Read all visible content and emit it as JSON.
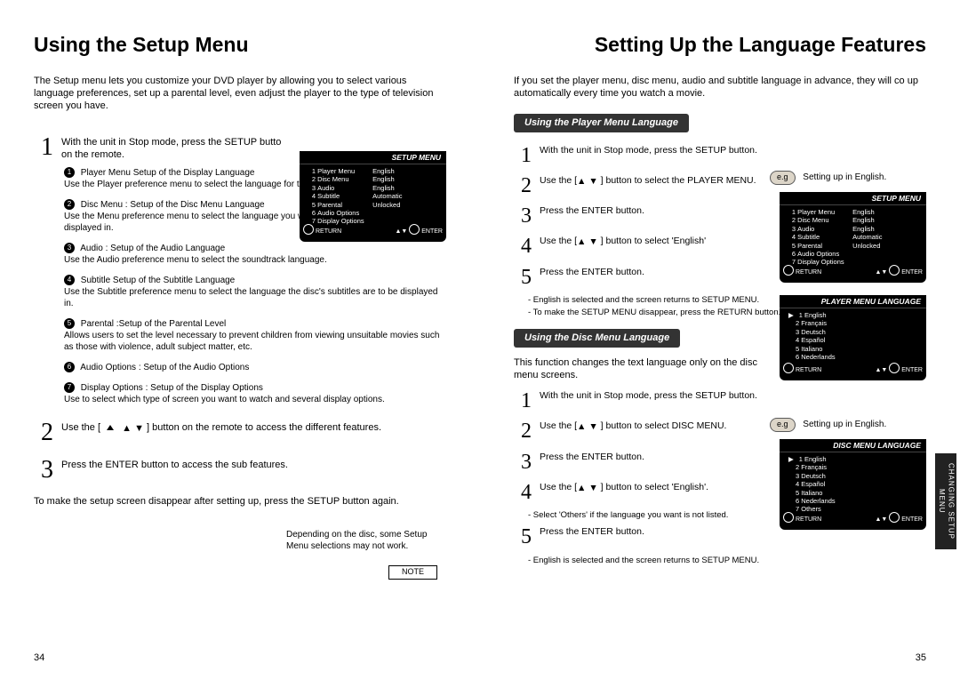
{
  "left": {
    "title": "Using the Setup Menu",
    "intro": "The Setup menu lets you customize your DVD player by allowing you to select various language preferences, set up a parental level, even adjust the player to the type of television screen you have.",
    "step1_a": "With the unit in Stop mode, press the SETUP butto",
    "step1_b": "on the remote.",
    "bullets": [
      {
        "num": "1",
        "lead": "Player Menu Setup of the Display Language",
        "body": "Use the Player preference menu to select the language for the player's on-screen displays."
      },
      {
        "num": "2",
        "lead": "Disc Menu : Setup of the Disc Menu Language",
        "body": "Use the Menu preference menu to select the language you want a DVD's disc menu to be displayed in."
      },
      {
        "num": "3",
        "lead": "Audio : Setup of the Audio Language",
        "body": "Use the Audio preference menu to select the soundtrack language."
      },
      {
        "num": "4",
        "lead": "Subtitle Setup of the Subtitle Language",
        "body": "Use the Subtitle preference menu to select the language the disc's subtitles are to be displayed in."
      },
      {
        "num": "5",
        "lead": "Parental :Setup of the Parental Level",
        "body": "Allows users to set the level necessary to prevent children from viewing unsuitable movies such as those with violence, adult subject matter, etc."
      },
      {
        "num": "6",
        "lead": "Audio Options : Setup of the Audio Options",
        "body": ""
      },
      {
        "num": "7",
        "lead": "Display Options : Setup of the Display Options",
        "body": "Use to select which type of screen you want to watch and several display options."
      }
    ],
    "step2_a": "Use the [",
    "step2_b": "] button on the remote to access the different features.",
    "step3": "Press the ENTER button to access the sub features.",
    "endnote": "To make the setup screen disappear after setting up, press the SETUP button again.",
    "note_label": "NOTE",
    "note_text": "Depending on the disc, some Setup Menu selections may not work.",
    "pagenum": "34",
    "screen": {
      "title": "SETUP MENU",
      "rows": [
        {
          "n": "1",
          "k": "Player Menu",
          "v": "English"
        },
        {
          "n": "2",
          "k": "Disc Menu",
          "v": "English"
        },
        {
          "n": "3",
          "k": "Audio",
          "v": "English"
        },
        {
          "n": "4",
          "k": "Subtitle",
          "v": "Automatic"
        },
        {
          "n": "5",
          "k": "Parental",
          "v": "Unlocked"
        },
        {
          "n": "6",
          "k": "Audio Options",
          "v": ""
        },
        {
          "n": "7",
          "k": "Display Options",
          "v": ""
        }
      ],
      "return": "RETURN",
      "enter": "ENTER"
    }
  },
  "right": {
    "title": "Setting Up the Language Features",
    "intro": "If you set the player menu, disc menu, audio and subtitle language in advance, they will co up automatically every time you watch a movie.",
    "pill1": "Using the Player Menu Language",
    "p1": {
      "s1": "With the unit in Stop mode, press the SETUP button.",
      "s2a": "Use the [",
      "s2b": "] button to select the PLAYER MENU.",
      "s3": "Press the ENTER button.",
      "s4a": "Use the [",
      "s4b": "] button to select 'English'",
      "s5": "Press the ENTER button.",
      "n1": "- English is selected and the screen returns to SETUP MENU.",
      "n2": "- To make the SETUP MENU disappear, press the RETURN button."
    },
    "pill2": "Using the Disc Menu Language",
    "p2_intro": "This function changes the text language only on the disc menu screens.",
    "p2": {
      "s1": "With the unit in Stop mode, press the SETUP button.",
      "s2a": "Use the [",
      "s2b": "] button to select DISC MENU.",
      "s3": "Press the ENTER button.",
      "s4a": "Use the [",
      "s4b": "] button to select 'English'.",
      "n1": "- Select 'Others' if the language you want is not listed.",
      "s5": "Press the ENTER button.",
      "n2": "- English is selected and the screen returns to SETUP MENU."
    },
    "eg_label": "e.g",
    "eg_text": "Setting up in English.",
    "screen_setup": {
      "title": "SETUP MENU",
      "rows": [
        {
          "n": "1",
          "k": "Player Menu",
          "v": "English"
        },
        {
          "n": "2",
          "k": "Disc Menu",
          "v": "English"
        },
        {
          "n": "3",
          "k": "Audio",
          "v": "English"
        },
        {
          "n": "4",
          "k": "Subtitle",
          "v": "Automatic"
        },
        {
          "n": "5",
          "k": "Parental",
          "v": "Unlocked"
        },
        {
          "n": "6",
          "k": "Audio Options",
          "v": ""
        },
        {
          "n": "7",
          "k": "Display Options",
          "v": ""
        }
      ],
      "return": "RETURN",
      "enter": "ENTER"
    },
    "screen_player": {
      "title": "PLAYER MENU LANGUAGE",
      "rows": [
        {
          "n": "1",
          "k": "English",
          "v": ""
        },
        {
          "n": "2",
          "k": "Français",
          "v": ""
        },
        {
          "n": "3",
          "k": "Deutsch",
          "v": ""
        },
        {
          "n": "4",
          "k": "Español",
          "v": ""
        },
        {
          "n": "5",
          "k": "Italiano",
          "v": ""
        },
        {
          "n": "6",
          "k": "Nederlands",
          "v": ""
        }
      ],
      "return": "RETURN",
      "enter": "ENTER"
    },
    "screen_disc": {
      "title": "DISC MENU LANGUAGE",
      "rows": [
        {
          "n": "1",
          "k": "English",
          "v": ""
        },
        {
          "n": "2",
          "k": "Français",
          "v": ""
        },
        {
          "n": "3",
          "k": "Deutsch",
          "v": ""
        },
        {
          "n": "4",
          "k": "Español",
          "v": ""
        },
        {
          "n": "5",
          "k": "Italiano",
          "v": ""
        },
        {
          "n": "6",
          "k": "Nederlands",
          "v": ""
        },
        {
          "n": "7",
          "k": "Others",
          "v": ""
        }
      ],
      "return": "RETURN",
      "enter": "ENTER"
    },
    "vert_tab": "CHANGING\nSETUP MENU",
    "pagenum": "35"
  }
}
